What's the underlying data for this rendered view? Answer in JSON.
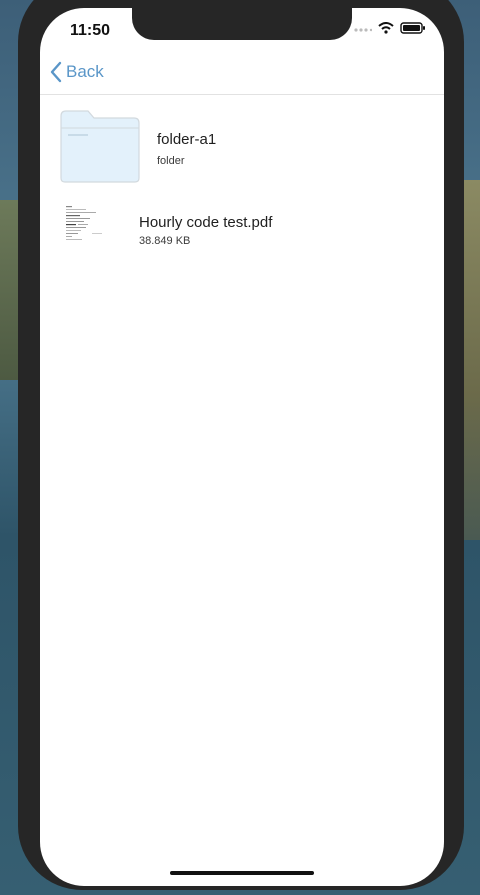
{
  "status_bar": {
    "time": "11:50"
  },
  "nav": {
    "back_label": "Back"
  },
  "items": [
    {
      "name": "folder-a1",
      "detail": "folder",
      "kind": "folder"
    },
    {
      "name": "Hourly code test.pdf",
      "detail": "38.849 KB",
      "kind": "pdf"
    }
  ],
  "colors": {
    "accent": "#5a96c8",
    "folder_fill": "#e3f1fb"
  },
  "icons": [
    "chevron-left-icon",
    "wifi-icon",
    "battery-icon",
    "folder-icon"
  ]
}
